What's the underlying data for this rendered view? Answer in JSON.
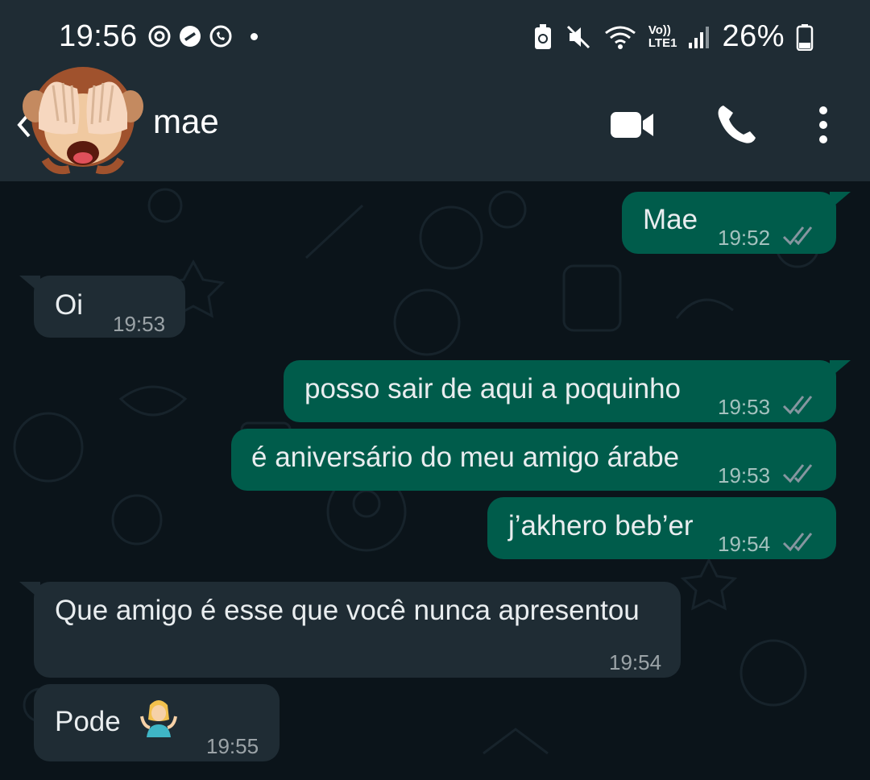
{
  "status_bar": {
    "time": "19:56",
    "battery": "26%",
    "network_label_top": "Vo))",
    "network_label_bottom": "LTE1"
  },
  "header": {
    "contact_name": "mae",
    "avatar_icon": "monkey-see-no-evil-emoji"
  },
  "colors": {
    "outgoing_bubble": "#005c4b",
    "incoming_bubble": "#1f2c34",
    "header_bg": "#1f2c34",
    "chat_bg": "#0b141a",
    "read_ticks": "#8696a0"
  },
  "messages": [
    {
      "direction": "out",
      "text": "Mae",
      "time": "19:52",
      "status": "read"
    },
    {
      "direction": "in",
      "text": "Oi",
      "time": "19:53"
    },
    {
      "direction": "out",
      "text": "posso sair de aqui a poquinho",
      "time": "19:53",
      "status": "read"
    },
    {
      "direction": "out",
      "text": "é aniversário do meu amigo árabe",
      "time": "19:53",
      "status": "read"
    },
    {
      "direction": "out",
      "text": "j’akhero beb’er",
      "time": "19:54",
      "status": "read"
    },
    {
      "direction": "in",
      "text": "Que amigo é esse que você nunca apresentou",
      "time": "19:54"
    },
    {
      "direction": "in",
      "text": "Pode",
      "time": "19:55",
      "emoji": "person-shrugging-emoji"
    }
  ]
}
